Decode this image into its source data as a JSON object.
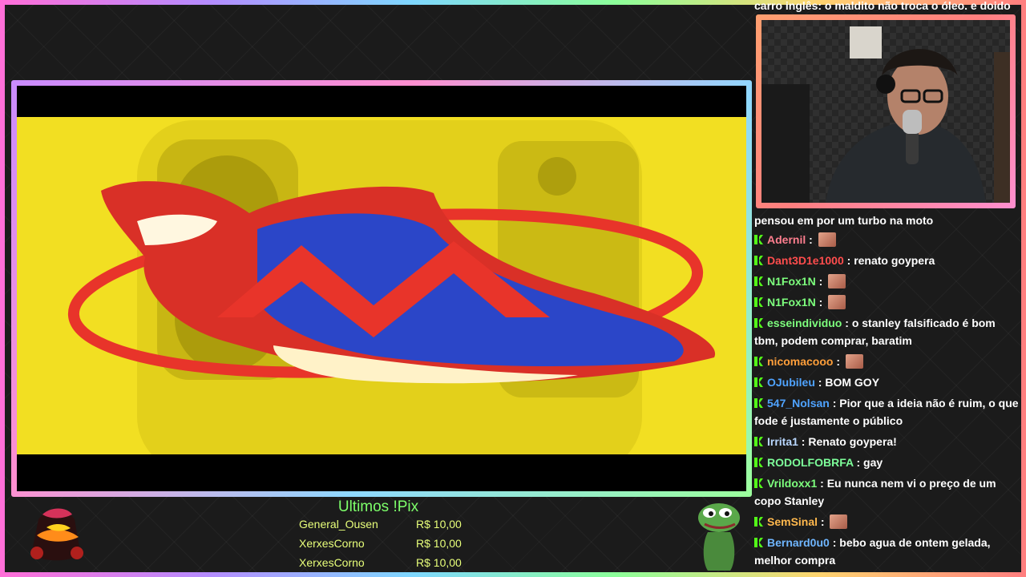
{
  "bottom_bar": {
    "pix_title": "Ultimos !Pix",
    "pix_entries": [
      {
        "name": "General_Ousen",
        "amount": "R$ 10,00"
      },
      {
        "name": "XerxesCorno",
        "amount": "R$ 10,00"
      },
      {
        "name": "XerxesCorno",
        "amount": "R$ 10,00"
      }
    ]
  },
  "chat": {
    "top_cut_text": "carro inglês: o maldito não troca o óleo. e doido",
    "continuation_text": "pensou em por um turbo na moto",
    "messages": [
      {
        "user": "Adernil",
        "color": "#ff7f8f",
        "text": "",
        "emote": true
      },
      {
        "user": "Dant3D1e1000",
        "color": "#ff4d4d",
        "text": "renato goypera",
        "emote": false
      },
      {
        "user": "N1Fox1N",
        "color": "#7dff7d",
        "text": "",
        "emote": true
      },
      {
        "user": "N1Fox1N",
        "color": "#7dff7d",
        "text": "",
        "emote": true
      },
      {
        "user": "esseindividuo",
        "color": "#7dff7d",
        "text": "o stanley falsificado é bom tbm, podem comprar, baratim",
        "emote": false
      },
      {
        "user": "nicomacooo",
        "color": "#ff9f3a",
        "text": "",
        "emote": true
      },
      {
        "user": "OJubileu",
        "color": "#4fa3ff",
        "text": "BOM GOY",
        "emote": false
      },
      {
        "user": "547_Nolsan",
        "color": "#4fa3ff",
        "text": "Pior que a ideia não é ruim, o que fode é justamente o público",
        "emote": false
      },
      {
        "user": "Irrita1",
        "color": "#b9d7ff",
        "text": "Renato goypera!",
        "emote": false
      },
      {
        "user": "RODOLFOBRFA",
        "color": "#7dff9a",
        "text": "gay",
        "emote": false
      },
      {
        "user": "Vrildoxx1",
        "color": "#7dff7d",
        "text": "Eu nunca nem vi o preço de um copo Stanley",
        "emote": false
      },
      {
        "user": "SemSinal",
        "color": "#ffb84d",
        "text": "",
        "emote": true
      },
      {
        "user": "Bernard0u0",
        "color": "#6fb6ff",
        "text": "bebo agua de ontem gelada, melhor compra",
        "emote": false
      }
    ]
  },
  "colors": {
    "accent_green": "#53fc18",
    "video_yellow": "#f2df22"
  }
}
